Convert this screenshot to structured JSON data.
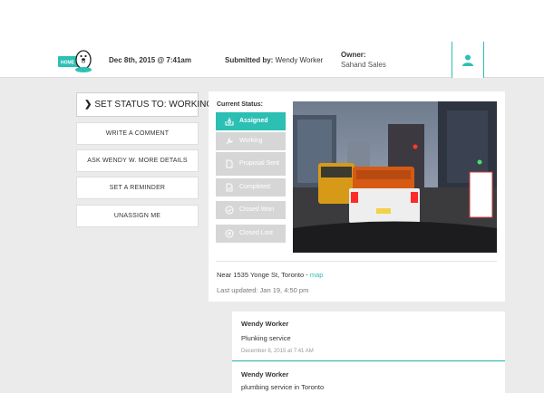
{
  "header": {
    "logo_text": "HOME",
    "date": "Dec 8th, 2015 @ 7:41am",
    "submitted_label": "Submitted by:",
    "submitted_name": "Wendy Worker",
    "owner_label": "Owner:",
    "owner_name": "Sahand Sales"
  },
  "actions": {
    "set_status": "SET STATUS TO: WORKING",
    "comment": "WRITE A COMMENT",
    "ask": "ASK WENDY W. MORE DETAILS",
    "reminder": "SET A REMINDER",
    "unassign": "UNASSIGN ME"
  },
  "status": {
    "label": "Current Status:",
    "items": [
      {
        "label": "Assigned",
        "icon": "inbox-icon",
        "active": true
      },
      {
        "label": "Working",
        "icon": "wrench-icon",
        "active": false
      },
      {
        "label": "Proposal Sent",
        "icon": "document-icon",
        "active": false
      },
      {
        "label": "Completed",
        "icon": "document-check-icon",
        "active": false
      },
      {
        "label": "Closed Won",
        "icon": "check-circle-icon",
        "active": false
      },
      {
        "label": "Closed Lost",
        "icon": "x-circle-icon",
        "active": false
      }
    ]
  },
  "location": {
    "text": "Near 1535 Yonge St, Toronto -",
    "link": "map"
  },
  "updated": "Last updated: Jan 19, 4:50 pm",
  "comments": [
    {
      "author": "Wendy Worker",
      "body": "Plunking service",
      "time": "December 8, 2015 at 7:41 AM"
    },
    {
      "author": "Wendy Worker",
      "body": "plumbing service in Toronto",
      "time": ""
    }
  ],
  "colors": {
    "accent": "#2cbfb4",
    "inactive_status": "#d6d6d6",
    "background": "#ebebeb"
  }
}
